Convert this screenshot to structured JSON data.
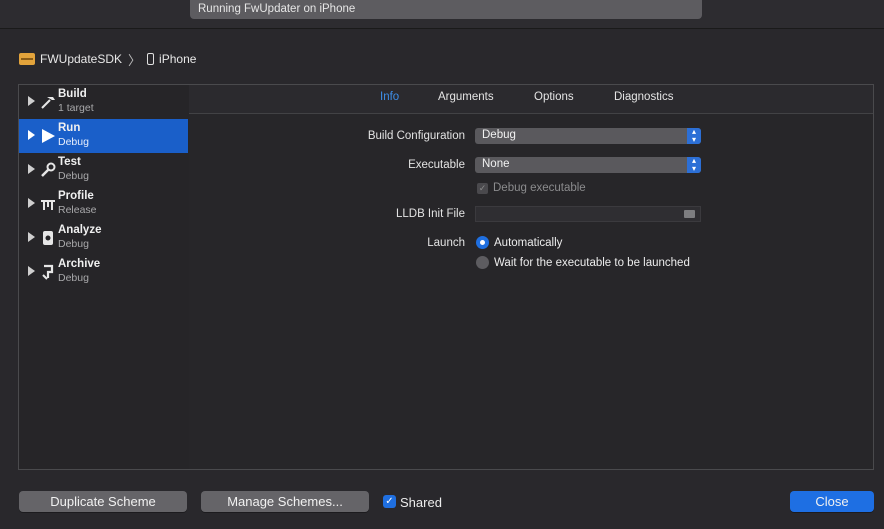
{
  "activity": {
    "text": "Running FwUpdater on iPhone"
  },
  "breadcrumb": {
    "scheme": "FWUpdateSDK",
    "destination": "iPhone"
  },
  "sidebar": {
    "items": [
      {
        "label": "Build",
        "sub": "1 target",
        "icon": "hammer-icon",
        "selected": false
      },
      {
        "label": "Run",
        "sub": "Debug",
        "icon": "play-icon",
        "selected": true
      },
      {
        "label": "Test",
        "sub": "Debug",
        "icon": "wrench-icon",
        "selected": false
      },
      {
        "label": "Profile",
        "sub": "Release",
        "icon": "instruments-icon",
        "selected": false
      },
      {
        "label": "Analyze",
        "sub": "Debug",
        "icon": "analyze-icon",
        "selected": false
      },
      {
        "label": "Archive",
        "sub": "Debug",
        "icon": "archive-icon",
        "selected": false
      }
    ]
  },
  "tabs": {
    "info": "Info",
    "arguments": "Arguments",
    "options": "Options",
    "diagnostics": "Diagnostics",
    "active": "Info"
  },
  "form": {
    "build_configuration": {
      "label": "Build Configuration",
      "value": "Debug"
    },
    "executable": {
      "label": "Executable",
      "value": "None"
    },
    "debug_executable": {
      "label": "Debug executable",
      "checked": true,
      "enabled": false
    },
    "lldb_init_file": {
      "label": "LLDB Init File",
      "value": ""
    },
    "launch": {
      "label": "Launch",
      "options": [
        "Automatically",
        "Wait for the executable to be launched"
      ],
      "selected": "Automatically"
    }
  },
  "footer": {
    "duplicate": "Duplicate Scheme",
    "manage": "Manage Schemes...",
    "shared": {
      "label": "Shared",
      "checked": true
    },
    "close": "Close"
  },
  "colors": {
    "accent": "#1e6fe3",
    "active_tab": "#3d8ee8",
    "sidebar_selected": "#1a5fc9"
  }
}
